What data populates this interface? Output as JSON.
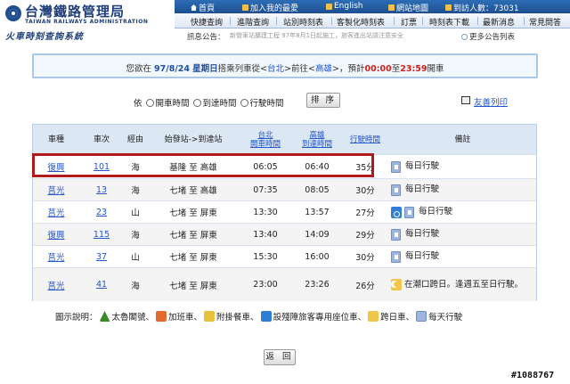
{
  "header": {
    "logo_title": "台灣鐵路管理局",
    "logo_subtitle": "TAIWAN RAILWAYS ADMINISTRATION",
    "system_name": "火車時刻查詢系統",
    "topbar": {
      "home": "首頁",
      "favorite": "加入我的最愛",
      "english": "English",
      "sitemap": "網站地圖",
      "visitors": "到訪人數：73031"
    },
    "menu": [
      "快捷查詢",
      "進階查詢",
      "站別時刻表",
      "客製化時刻表",
      "訂票",
      "時刻表下載",
      "最新消息",
      "常見問答"
    ],
    "notice_label": "訊息公告：",
    "notice_text": "新營車站擴建工程 97年8月1日起施工，旅客進出站請注意安全",
    "more_notices": "更多公告列表"
  },
  "query": {
    "prefix": "您欲在",
    "date": "97/8/24",
    "weekday": "星期日",
    "mid1": "搭乘列車從<",
    "from": "台北",
    "mid2": ">前往<",
    "to": "高雄",
    "mid3": ">，預計",
    "time_from": "00:00",
    "mid4": "至",
    "time_to": "23:59",
    "suffix": "開車"
  },
  "sort": {
    "label": "依",
    "options": [
      "開車時間",
      "到達時間",
      "行駛時間"
    ],
    "button": "排 序",
    "print": "友善列印"
  },
  "table": {
    "headers": {
      "type": "車種",
      "number": "車次",
      "route": "經由",
      "stations": "始發站->到達站",
      "depart": "台北\n開車時間",
      "arrive": "高雄\n到達時間",
      "duration": "行駛時間",
      "note": "備註"
    },
    "rows": [
      {
        "type": "復興",
        "number": "101",
        "route": "海",
        "stations": "基隆 至 高雄",
        "depart": "06:05",
        "arrive": "06:40",
        "duration": "35分",
        "note": "每日行駛",
        "icons": [
          "daily"
        ]
      },
      {
        "type": "莒光",
        "number": "13",
        "route": "海",
        "stations": "七堵 至 高雄",
        "depart": "07:35",
        "arrive": "08:05",
        "duration": "30分",
        "note": "每日行駛",
        "icons": [
          "daily"
        ]
      },
      {
        "type": "莒光",
        "number": "23",
        "route": "山",
        "stations": "七堵 至 屏東",
        "depart": "13:30",
        "arrive": "13:57",
        "duration": "27分",
        "note": "每日行駛",
        "icons": [
          "wheel",
          "daily"
        ]
      },
      {
        "type": "復興",
        "number": "115",
        "route": "海",
        "stations": "七堵 至 屏東",
        "depart": "13:40",
        "arrive": "14:09",
        "duration": "29分",
        "note": "每日行駛",
        "icons": [
          "daily"
        ]
      },
      {
        "type": "莒光",
        "number": "37",
        "route": "山",
        "stations": "七堵 至 屏東",
        "depart": "15:30",
        "arrive": "16:00",
        "duration": "30分",
        "note": "每日行駛",
        "icons": [
          "daily"
        ]
      },
      {
        "type": "莒光",
        "number": "41",
        "route": "海",
        "stations": "七堵 至 屏東",
        "depart": "23:00",
        "arrive": "23:26",
        "duration": "26分",
        "note": "在潮口跨日。逢週五至日行駛。",
        "icons": [
          "moon"
        ]
      }
    ]
  },
  "legend": {
    "label": "圖示說明：",
    "items": [
      "太魯閣號、",
      "加班車、",
      "附掛餐車、",
      "設殘障旅客專用座位車、",
      "跨日車、",
      "每天行駛"
    ]
  },
  "back_button": "返 回",
  "watermark": "#1088767",
  "colors": {
    "brand_blue": "#1f4f8f",
    "header_bg": "#dbe7f3",
    "highlight": "#b01a1a",
    "link": "#2255cc"
  }
}
